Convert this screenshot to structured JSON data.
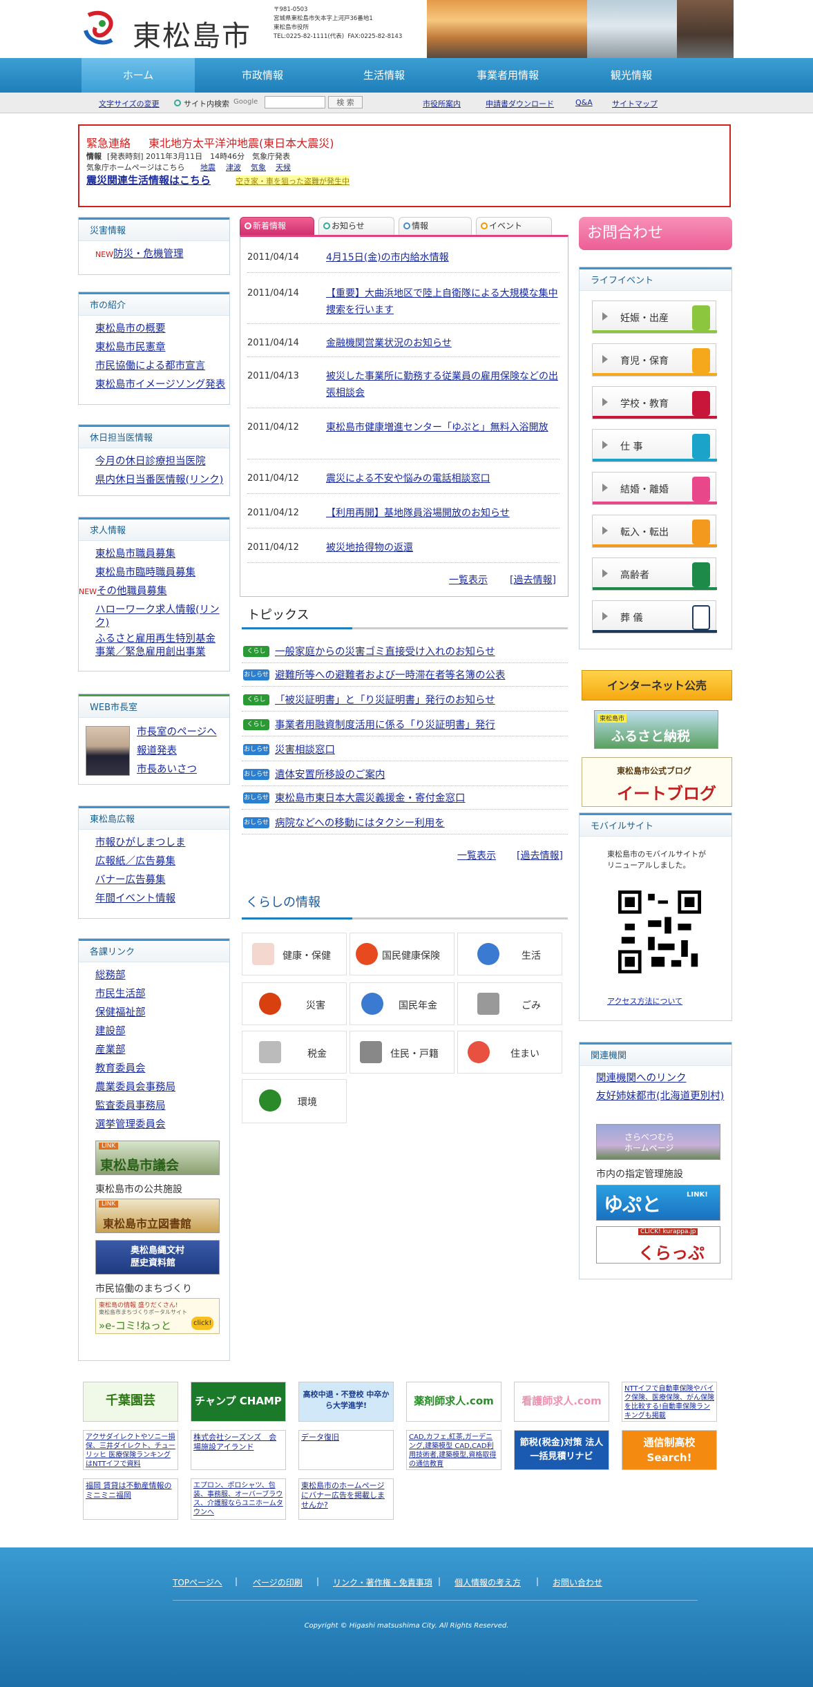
{
  "header": {
    "city_name": "東松島市",
    "address": "〒981-0503\n宮城県東松島市矢本字上河戸36番地1\n東松島市役所\nTEL:0225-82-1111(代表)  FAX:0225-82-8143"
  },
  "nav": {
    "home": "ホーム",
    "city": "市政情報",
    "life": "生活情報",
    "business": "事業者用情報",
    "tourism": "観光情報"
  },
  "util": {
    "font_size": "文字サイズの変更",
    "site_search": "サイト内検索",
    "google": "Google",
    "search_placeholder": "",
    "search_button": "検 索",
    "office_guide": "市役所案内",
    "forms": "申請書ダウンロード",
    "qa": "Q&A",
    "sitemap": "サイトマップ"
  },
  "emergency": {
    "label": "緊急連絡",
    "title": "東北地方太平洋沖地震(東日本大震災)",
    "info_label": "情報",
    "info_text": "[発表時刻] 2011年3月11日　14時46分　気象庁発表",
    "jma_text": "気象庁ホームページはこちら",
    "jma_links": [
      "地震",
      "津波",
      "気象",
      "天候"
    ],
    "life_info": "震災関連生活情報はこちら",
    "warning": "空き家・車を狙った盗難が発生中"
  },
  "left": {
    "disaster": {
      "title": "災害情報",
      "new_mark": "NEW",
      "items": [
        "防災・危機管理"
      ]
    },
    "intro": {
      "title": "市の紹介",
      "items": [
        "東松島市の概要",
        "東松島市民憲章",
        "市民協働による都市宣言",
        "東松島市イメージソング発表"
      ]
    },
    "holiday": {
      "title": "休日担当医情報",
      "items": [
        "今月の休日診療担当医院",
        "県内休日当番医情報(リンク)"
      ]
    },
    "jobs": {
      "title": "求人情報",
      "new_mark": "NEW",
      "items": [
        "東松島市職員募集",
        "東松島市臨時職員募集",
        "その他職員募集",
        "ハローワーク求人情報(リンク)",
        "ふるさと雇用再生特別基金事業／緊急雇用創出事業"
      ]
    },
    "mayor": {
      "title": "WEB市長室",
      "items": [
        "市長室のページへ",
        "報道発表",
        "市長あいさつ"
      ]
    },
    "pr": {
      "title": "東松島広報",
      "items": [
        "市報ひがしまつしま",
        "広報紙／広告募集",
        "バナー広告募集",
        "年間イベント情報"
      ]
    },
    "depts": {
      "title": "各課リンク",
      "items": [
        "総務部",
        "市民生活部",
        "保健福祉部",
        "建設部",
        "産業部",
        "教育委員会",
        "農業委員会事務局",
        "監査委員事務局",
        "選挙管理委員会"
      ]
    },
    "banners": {
      "council_link": "LINK",
      "council": "東松島市議会",
      "facilities": "東松島市の公共施設",
      "library_link": "LINK",
      "library": "東松島市立図書館",
      "museum": "奥松島縄文村\n歴史資料館",
      "community": "市民協働のまちづくり",
      "ecomi_top": "東松島の情報 盛りだくさん!",
      "ecomi_sub": "東松島市まちづくりポータルサイト",
      "ecomi": "»e-コミ!ねっと",
      "ecomi_click": "click!"
    }
  },
  "news": {
    "tabs": [
      "新着情報",
      "お知らせ",
      "情報",
      "イベント"
    ],
    "items": [
      {
        "date": "2011/04/14",
        "title": "4月15日(金)の市内給水情報"
      },
      {
        "date": "2011/04/14",
        "title": "【重要】大曲浜地区で陸上自衛隊による大規模な集中捜索を行います"
      },
      {
        "date": "2011/04/14",
        "title": "金融機関営業状況のお知らせ"
      },
      {
        "date": "2011/04/13",
        "title": "被災した事業所に勤務する従業員の雇用保険などの出張相談会"
      },
      {
        "date": "2011/04/12",
        "title": "東松島市健康増進センター「ゆぷと」無料入浴開放"
      },
      {
        "date": "2011/04/12",
        "title": "震災による不安や悩みの電話相談窓口"
      },
      {
        "date": "2011/04/12",
        "title": "【利用再開】基地隊員浴場開放のお知らせ"
      },
      {
        "date": "2011/04/12",
        "title": "被災地拾得物の返還"
      }
    ],
    "list_all": "一覧表示",
    "past": "[過去情報]"
  },
  "topics": {
    "title": "トピックス",
    "items": [
      {
        "badge": "くらし",
        "title": "一般家庭からの災害ゴミ直接受け入れのお知らせ"
      },
      {
        "badge": "おしらせ",
        "title": "避難所等への避難者および一時滞在者等名簿の公表"
      },
      {
        "badge": "くらし",
        "title": "「被災証明書」と「り災証明書」発行のお知らせ"
      },
      {
        "badge": "くらし",
        "title": "事業者用融資制度活用に係る「り災証明書」発行"
      },
      {
        "badge": "おしらせ",
        "title": "災害相談窓口"
      },
      {
        "badge": "おしらせ",
        "title": "遺体安置所移設のご案内"
      },
      {
        "badge": "おしらせ",
        "title": "東松島市東日本大震災義援金・寄付金窓口"
      },
      {
        "badge": "おしらせ",
        "title": "病院などへの移動にはタクシー利用を"
      }
    ],
    "list_all": "一覧表示",
    "past": "[過去情報]"
  },
  "living": {
    "title": "くらしの情報",
    "items": [
      "健康・保健",
      "国民健康保険",
      "生活",
      "災害",
      "国民年金",
      "ごみ",
      "税金",
      "住民・戸籍",
      "住まい",
      "環境"
    ]
  },
  "right": {
    "contact": "お問合わせ",
    "life_event": {
      "title": "ライフイベント",
      "items": [
        "妊娠・出産",
        "育児・保育",
        "学校・教育",
        "仕 事",
        "結婚・離婚",
        "転入・転出",
        "高齢者",
        "葬 儀"
      ]
    },
    "internet_auction": "インターネット公売",
    "furusato_tag": "東松島市",
    "furusato": "ふるさと納税",
    "blog_top": "東松島市公式ブログ",
    "blog": "イートブログ",
    "mobile": {
      "title": "モバイルサイト",
      "text": "東松島市のモバイルサイトがリニューアルしました。",
      "access": "アクセス方法について"
    },
    "related": {
      "title": "関連機関",
      "links": [
        "関連機関へのリンク",
        "友好姉妹都市(北海道更別村)"
      ],
      "sarabetsu": "さらべつむら\nホームページ",
      "managed": "市内の指定管理施設",
      "yupuhto": "ゆぷと",
      "link_word": "LINK!",
      "kurappu_click": "CLICK! kurappa.jp",
      "kurappu": "くらっぷ"
    }
  },
  "ads": [
    "千葉園芸",
    "チャンプ CHAMP",
    "高校中退・不登校 中卒から大学進学!",
    "薬剤師求人.com",
    "看護師求人.com",
    "NTTイフで自動車保険やバイク保険、医療保険、がん保険を比較する!自動車保険ランキングも掲載",
    "アクサダイレクトやソニー損保、三井ダイレクト、チューリッヒ 医療保険ランキングはNTTイフで資料",
    "株式会社シーズンズ　会場施設アイランド",
    "データ復旧",
    "CAD,カフェ,紅茶,ガーデニング,建築模型 CAD,CAD利用技術者,建築模型,資格取得の通信教育",
    "節税(税金)対策 法人 一括見積リナビ",
    "通信制高校 Search!",
    "福岡 賃貸は不動産情報のミニミニ福岡",
    "エプロン、ポロシャツ、包装、事務服、オーバーブラウス、介護服ならユニホームタウンへ",
    "東松島市のホームページにバナー広告を掲載しませんか?"
  ],
  "footer": {
    "links": [
      "TOPページへ",
      "ページの印刷",
      "リンク・著作権・免責事項",
      "個人情報の考え方",
      "お問い合わせ"
    ],
    "copyright": "Copyright © Higashi matsushima City. All Rights Reserved."
  },
  "colors": {
    "nav": "#1e7fba",
    "accent_pink": "#ec5e96",
    "emergency_red": "#d02020"
  }
}
